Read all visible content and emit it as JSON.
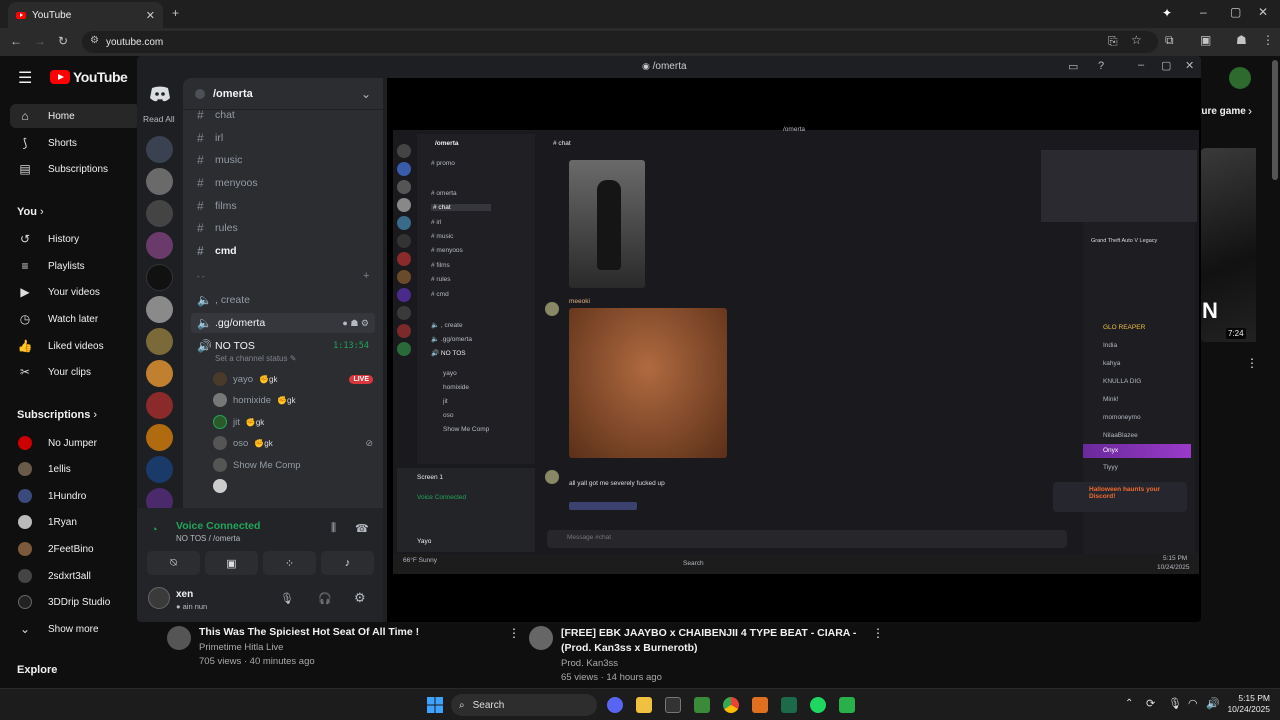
{
  "browser": {
    "tab_title": "YouTube",
    "url": "youtube.com"
  },
  "youtube": {
    "logo_text": "YouTube",
    "nav": [
      {
        "label": "Home",
        "icon": "home-icon"
      },
      {
        "label": "Shorts",
        "icon": "shorts-icon"
      },
      {
        "label": "Subscriptions",
        "icon": "subscriptions-icon"
      }
    ],
    "you_header": "You",
    "you_items": [
      {
        "label": "History",
        "icon": "history-icon"
      },
      {
        "label": "Playlists",
        "icon": "playlists-icon"
      },
      {
        "label": "Your videos",
        "icon": "your-videos-icon"
      },
      {
        "label": "Watch later",
        "icon": "watch-later-icon"
      },
      {
        "label": "Liked videos",
        "icon": "liked-videos-icon"
      },
      {
        "label": "Your clips",
        "icon": "clips-icon"
      }
    ],
    "subs_header": "Subscriptions",
    "subscriptions": [
      "No Jumper",
      "1ellis",
      "1Hundro",
      "1Ryan",
      "2FeetBino",
      "2sdxrt3all",
      "3DDrip Studio"
    ],
    "show_more": "Show more",
    "explore": "Explore",
    "right_label": "ture game",
    "thumb_duration": "7:24",
    "videos": [
      {
        "title": "This Was The Spiciest Hot Seat Of All Time !",
        "channel": "Primetime Hitla Live",
        "meta": "705 views · 40 minutes ago"
      },
      {
        "title": "[FREE] EBK JAAYBO x CHAIBENJII 4 TYPE BEAT - CIARA - (Prod. Kan3ss x Burnerotb)",
        "channel": "Prod. Kan3ss",
        "meta": "65 views · 14 hours ago"
      }
    ]
  },
  "discord": {
    "window_title": "/omerta",
    "read_all": "Read All",
    "server_name": "/omerta",
    "channels": [
      "chat",
      "irl",
      "music",
      "menyoos",
      "films",
      "rules",
      "cmd"
    ],
    "category_label": "- -",
    "voice_channels": [
      ", create",
      ".gg/omerta"
    ],
    "active_voice": {
      "name": "NO TOS",
      "timer": "1:13:54",
      "status": "Set a channel status"
    },
    "voice_users": [
      {
        "name": "yayo",
        "badge": "gk",
        "live": "LIVE"
      },
      {
        "name": "homixide",
        "badge": "gk"
      },
      {
        "name": "jit",
        "badge": "gk"
      },
      {
        "name": "oso",
        "badge": "gk"
      },
      {
        "name": "Show Me Comp",
        "badge": ""
      }
    ],
    "voice_connected": "Voice Connected",
    "voice_location": "NO TOS / /omerta",
    "user": {
      "name": "xen",
      "status": "ain nun"
    },
    "stream": {
      "title": "/omerta",
      "channel_header": "chat",
      "server": "/omerta",
      "channels": [
        "promo",
        "omerta",
        "chat",
        "irl",
        "music",
        "menyoos",
        "films",
        "rules",
        "cmd"
      ],
      "voice": [
        ", create",
        ".gg/omerta",
        "NO TOS"
      ],
      "voice_users": [
        "yayo",
        "homixide",
        "jit",
        "oso",
        "Show Me Comp"
      ],
      "messages": [
        {
          "author": "meeoki",
          "text": "all yall got me severely fucked up"
        }
      ],
      "input_placeholder": "Message #chat",
      "screen_label": "Screen 1",
      "voice_connected": "Voice Connected",
      "user": "Yayo",
      "game": "Grand Theft Auto V Legacy",
      "members": [
        "GLO REAPER",
        "India",
        "kahya",
        "KNULLA DIG",
        "Mink!",
        "momoneymo",
        "NilaaBlazee",
        "Onyx",
        "Tiyyy"
      ],
      "promo": "Halloween haunts your Discord!",
      "taskbar_search": "Search",
      "clock": "5:15 PM",
      "date": "10/24/2025",
      "weather": "66°F Sunny"
    }
  },
  "taskbar": {
    "search": "Search",
    "time": "5:15 PM",
    "date": "10/24/2025"
  },
  "colors": {
    "yt_red": "#ff0000",
    "discord_green": "#23a55a",
    "discord_bg": "#2b2d31",
    "live_red": "#da373c"
  }
}
